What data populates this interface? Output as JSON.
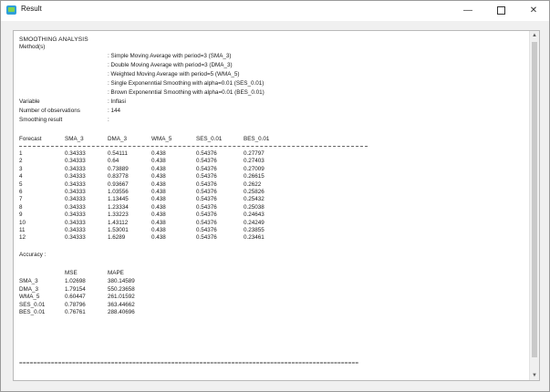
{
  "window": {
    "title": "Result",
    "controls": {
      "minimize": "—",
      "maximize": "",
      "close": "✕"
    }
  },
  "report": {
    "heading": "SMOOTHING ANALYSIS",
    "method_label": "Method(s)",
    "methods": [
      ": Simple Moving Average with period=3 (SMA_3)",
      ": Double Moving Average with period=3 (DMA_3)",
      ": Weighted Moving Average with period=5 (WMA_5)",
      ": Single Exponenntial Smoothing with alpha=0.01 (SES_0.01)",
      ": Brown Exponenntial Smoothing with alpha=0.01 (BES_0.01)"
    ],
    "info": [
      {
        "label": "Variable",
        "value": ": Inflasi"
      },
      {
        "label": "Number of observations",
        "value": ": 144"
      },
      {
        "label": "Smoothing result",
        "value": ":"
      }
    ],
    "forecast_headers": [
      "Forecast",
      "SMA_3",
      "DMA_3",
      "WMA_5",
      "SES_0.01",
      "BES_0.01"
    ],
    "forecast_rows": [
      [
        "1",
        "0.34333",
        "0.54111",
        "0.438",
        "0.54376",
        "0.27797"
      ],
      [
        "2",
        "0.34333",
        "0.64",
        "0.438",
        "0.54376",
        "0.27403"
      ],
      [
        "3",
        "0.34333",
        "0.73889",
        "0.438",
        "0.54376",
        "0.27009"
      ],
      [
        "4",
        "0.34333",
        "0.83778",
        "0.438",
        "0.54376",
        "0.26615"
      ],
      [
        "5",
        "0.34333",
        "0.93667",
        "0.438",
        "0.54376",
        "0.2622"
      ],
      [
        "6",
        "0.34333",
        "1.03556",
        "0.438",
        "0.54376",
        "0.25826"
      ],
      [
        "7",
        "0.34333",
        "1.13445",
        "0.438",
        "0.54376",
        "0.25432"
      ],
      [
        "8",
        "0.34333",
        "1.23334",
        "0.438",
        "0.54376",
        "0.25038"
      ],
      [
        "9",
        "0.34333",
        "1.33223",
        "0.438",
        "0.54376",
        "0.24643"
      ],
      [
        "10",
        "0.34333",
        "1.43112",
        "0.438",
        "0.54376",
        "0.24249"
      ],
      [
        "11",
        "0.34333",
        "1.53001",
        "0.438",
        "0.54376",
        "0.23855"
      ],
      [
        "12",
        "0.34333",
        "1.6289",
        "0.438",
        "0.54376",
        "0.23461"
      ]
    ],
    "accuracy_label": "Accuracy :",
    "accuracy_headers": [
      "MSE",
      "MAPE"
    ],
    "accuracy_rows": [
      [
        "SMA_3",
        "1.02698",
        "380.14589"
      ],
      [
        "DMA_3",
        "1.79154",
        "550.23658"
      ],
      [
        "WMA_5",
        "0.60447",
        "261.01592"
      ],
      [
        "SES_0.01",
        "0.78796",
        "363.44662"
      ],
      [
        "BES_0.01",
        "0.76761",
        "288.40696"
      ]
    ],
    "end_line": "================================================================================================"
  },
  "scrollbar": {
    "up_icon": "▲",
    "down_icon": "▼"
  }
}
